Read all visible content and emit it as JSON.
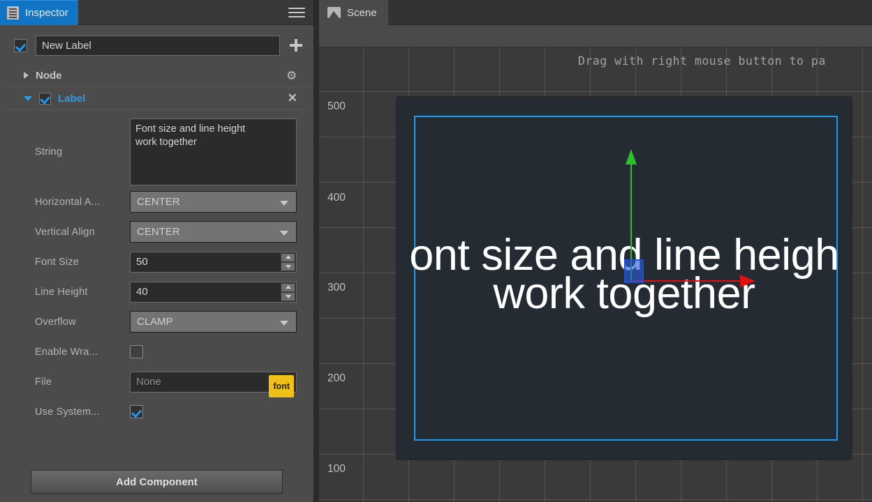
{
  "inspector": {
    "tab_label": "Inspector",
    "menu_icon": "hamburger-icon",
    "node_enabled": true,
    "node_name": "New Label",
    "add_icon": "plus-icon",
    "components": [
      {
        "title": "Node",
        "expanded": false,
        "icon": "gear-icon"
      },
      {
        "title": "Label",
        "expanded": true,
        "enabled": true,
        "icon": "close-icon"
      }
    ],
    "properties": [
      {
        "label": "String",
        "type": "textarea",
        "value": "Font size and line height\nwork together"
      },
      {
        "label": "Horizontal A...",
        "type": "select",
        "value": "CENTER"
      },
      {
        "label": "Vertical Align",
        "type": "select",
        "value": "CENTER"
      },
      {
        "label": "Font Size",
        "type": "spinner",
        "value": "50"
      },
      {
        "label": "Line Height",
        "type": "spinner",
        "value": "40"
      },
      {
        "label": "Overflow",
        "type": "select",
        "value": "CLAMP"
      },
      {
        "label": "Enable Wra...",
        "type": "checkbox",
        "value": false
      },
      {
        "label": "File",
        "type": "asset",
        "value": "None",
        "badge": "font"
      },
      {
        "label": "Use System...",
        "type": "checkbox",
        "value": true
      }
    ],
    "add_component_label": "Add Component"
  },
  "scene": {
    "tab_label": "Scene",
    "hint_text": "Drag with right mouse button to pa",
    "ruler_ticks": [
      "500",
      "400",
      "300",
      "200",
      "100"
    ],
    "label_text": "ont size and line heigh\nwork together",
    "gizmo": {
      "y_axis_color": "#2dc02d",
      "x_axis_color": "#dd1111",
      "handle_color": "#1b4fd8"
    },
    "selection_color": "#1d9bf0",
    "canvas_color": "#252b33"
  },
  "theme": {
    "accent": "#1275c4",
    "panel_bg": "#4b4b4b",
    "field_bg": "#2b2b2b",
    "badge_color": "#f0c018"
  }
}
